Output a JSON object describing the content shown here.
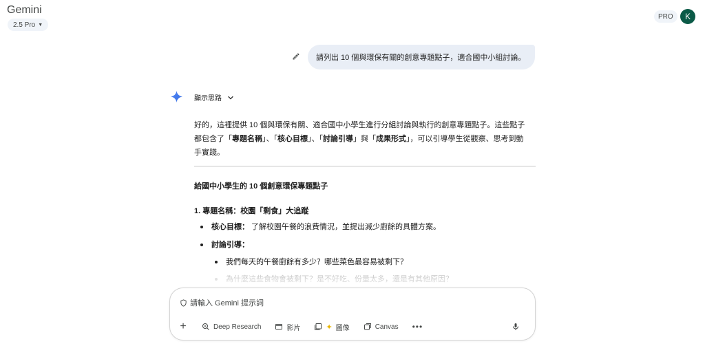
{
  "header": {
    "app_title": "Gemini",
    "model_label": "2.5 Pro",
    "pro_badge": "PRO",
    "avatar_initial": "K"
  },
  "conversation": {
    "user_message": "請列出 10 個與環保有關的創意專題點子，適合國中小組討論。",
    "thinking_label": "顯示思路",
    "intro": {
      "line1": "好的，這裡提供 10 個與環保有關、適合國中小學生進行分組討論與執行的創意專題點子。這些點子",
      "line2_prefix": "都包含了「",
      "term1": "專題名稱",
      "sep1": "」、「",
      "term2": "核心目標",
      "sep2": "」、「",
      "term3": "討論引導",
      "sep3": "」與「",
      "term4": "成果形式",
      "line2_suffix": "」，可以引導學生從觀察、思考到動",
      "line3": "手實踐。"
    },
    "heading": "給國中小學生的 10 個創意環保專題點子",
    "project1": {
      "title": "1. 專題名稱：校園「剩食」大追蹤",
      "goal_label": "核心目標：",
      "goal_text": " 了解校園午餐的浪費情況，並提出減少廚餘的具體方案。",
      "discussion_label": "討論引導：",
      "q1": "我們每天的午餐廚餘有多少？哪些菜色最容易被剩下？",
      "q2": "為什麼這些食物會被剩下？是不好吃、份量太多，還是有其他原因？"
    }
  },
  "input": {
    "placeholder": "請輸入 Gemini 提示詞",
    "tools": {
      "deep_research": "Deep Research",
      "video": "影片",
      "image": "圖像",
      "canvas": "Canvas"
    }
  },
  "colors": {
    "user_bubble": "#e9eef6",
    "avatar": "#0b5a47",
    "spark_blue": "#4f86f7"
  }
}
